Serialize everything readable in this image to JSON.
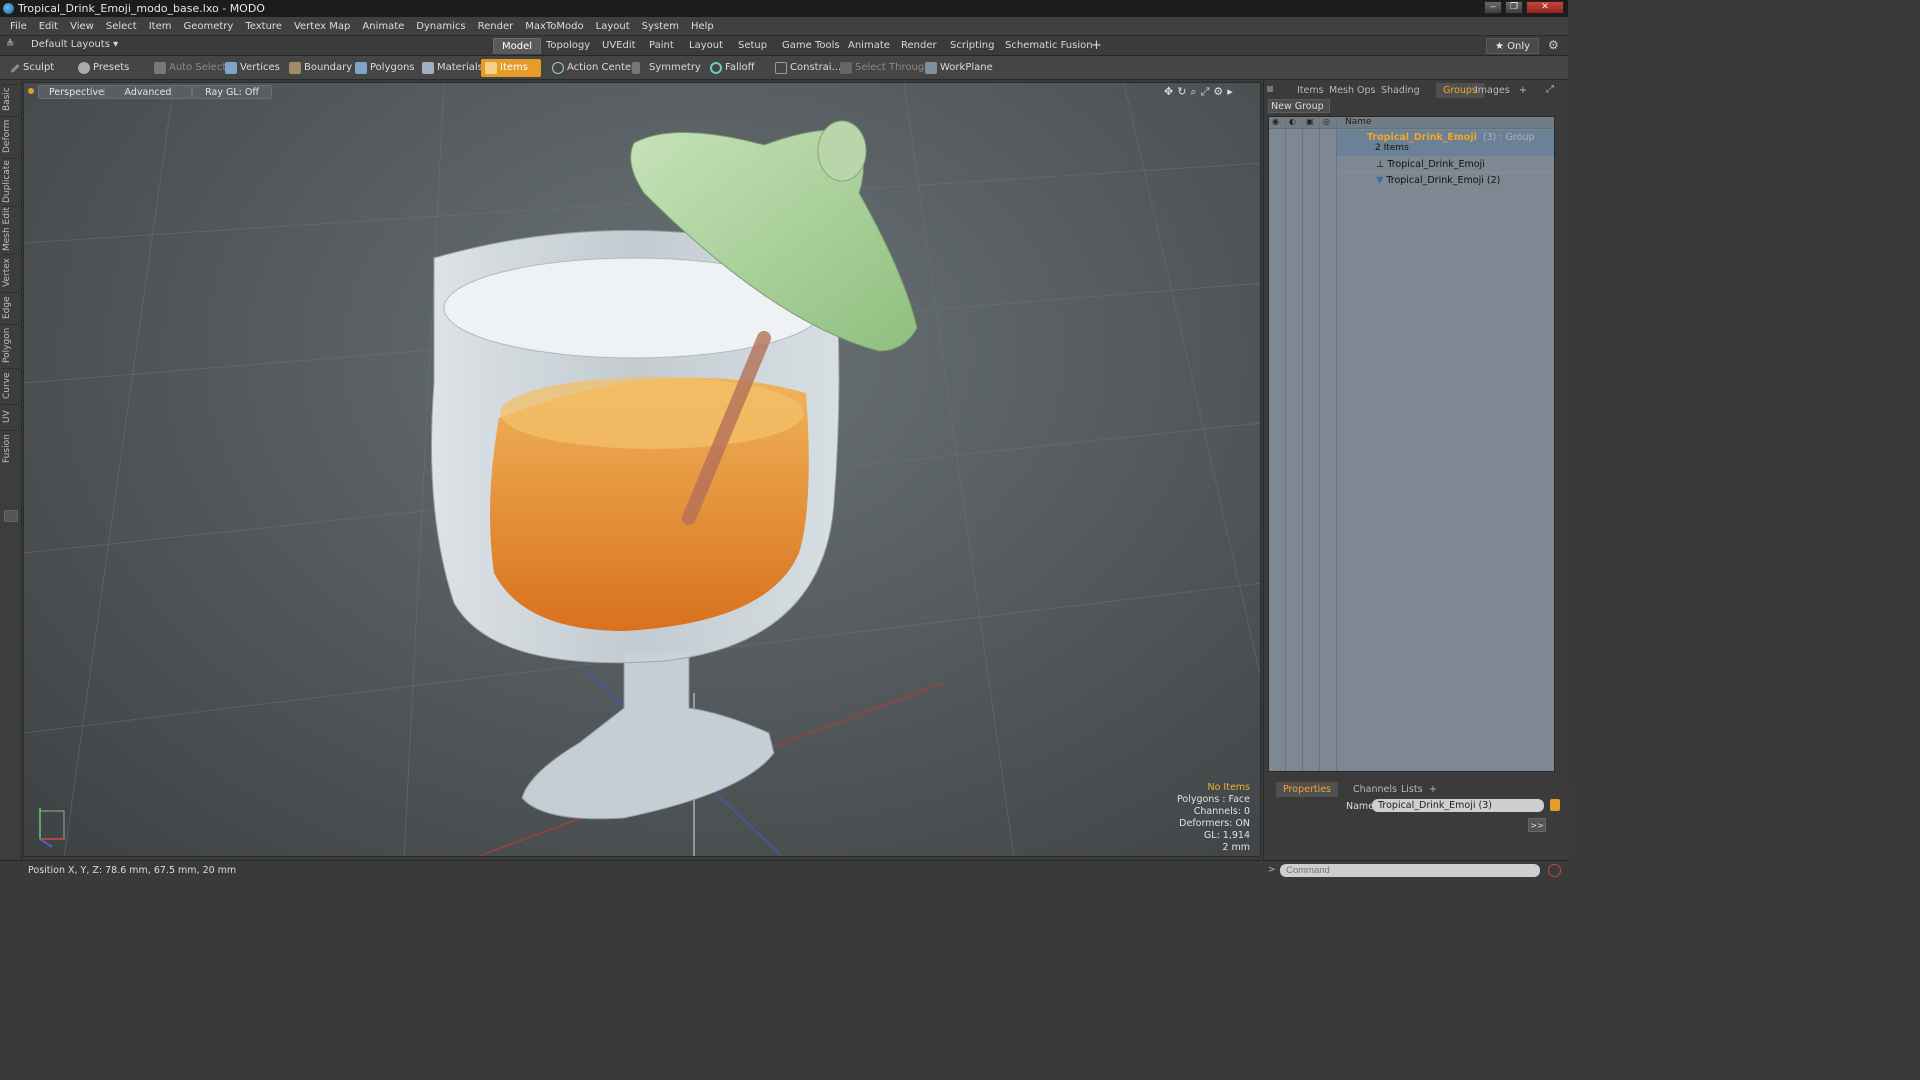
{
  "window": {
    "title": "Tropical_Drink_Emoji_modo_base.lxo - MODO",
    "buttons": [
      "‒",
      "❐",
      "✕"
    ]
  },
  "menu": [
    "File",
    "Edit",
    "View",
    "Select",
    "Item",
    "Geometry",
    "Texture",
    "Vertex Map",
    "Animate",
    "Dynamics",
    "Render",
    "MaxToModo",
    "Layout",
    "System",
    "Help"
  ],
  "layoutbar": {
    "layouts_label": "Default Layouts ▾",
    "tabs": [
      "Model",
      "Topology",
      "UVEdit",
      "Paint",
      "Layout",
      "Setup",
      "Game Tools",
      "Animate",
      "Render",
      "Scripting",
      "Schematic Fusion"
    ],
    "active_tab": "Model",
    "add": "+",
    "only_label": "★ Only"
  },
  "toolbar": {
    "sculpt": "Sculpt",
    "presets": "Presets",
    "auto_select": "Auto Select",
    "vertices": "Vertices",
    "boundary": "Boundary",
    "polygons": "Polygons",
    "materials": "Materials",
    "items": "Items",
    "action_center": "Action Center",
    "symmetry": "Symmetry",
    "falloff": "Falloff",
    "constraints": "Constrai...",
    "select_through": "Select Through",
    "workplane": "WorkPlane"
  },
  "left_tabs": [
    "Basic",
    "Deform",
    "Duplicate",
    "Mesh Edit",
    "Vertex",
    "Edge",
    "Polygon",
    "Curve",
    "UV",
    "Fusion"
  ],
  "viewport": {
    "view_label": "Perspective",
    "advanced_label": "Advanced",
    "raygl_label": "Ray GL: Off",
    "hud": [
      "No Items",
      "Polygons : Face",
      "Channels: 0",
      "Deformers: ON",
      "GL: 1,914",
      "2 mm"
    ]
  },
  "right_panel": {
    "tabs": [
      "Items",
      "Mesh Ops",
      "Shading",
      "Groups",
      "Images",
      "+"
    ],
    "active_tab": "Groups",
    "new_group": "New Group",
    "name_header": "Name",
    "group": {
      "name": "Tropical_Drink_Emoji",
      "suffix": "(3) : Group",
      "count": "2 Items"
    },
    "items": [
      "Tropical_Drink_Emoji",
      "Tropical_Drink_Emoji (2)"
    ]
  },
  "properties": {
    "tabs": [
      "Properties",
      "Channels",
      "Lists",
      "+"
    ],
    "name_label": "Name",
    "name_value": "Tropical_Drink_Emoji (3)",
    "more": ">>"
  },
  "status": {
    "position": "Position X, Y, Z:  78.6 mm, 67.5 mm, 20 mm",
    "command_placeholder": "Command"
  },
  "colors": {
    "accent": "#e79c2a",
    "liquid": "#e7892c",
    "umbrella": "#9ec88e",
    "glass": "#c9d3d8"
  }
}
